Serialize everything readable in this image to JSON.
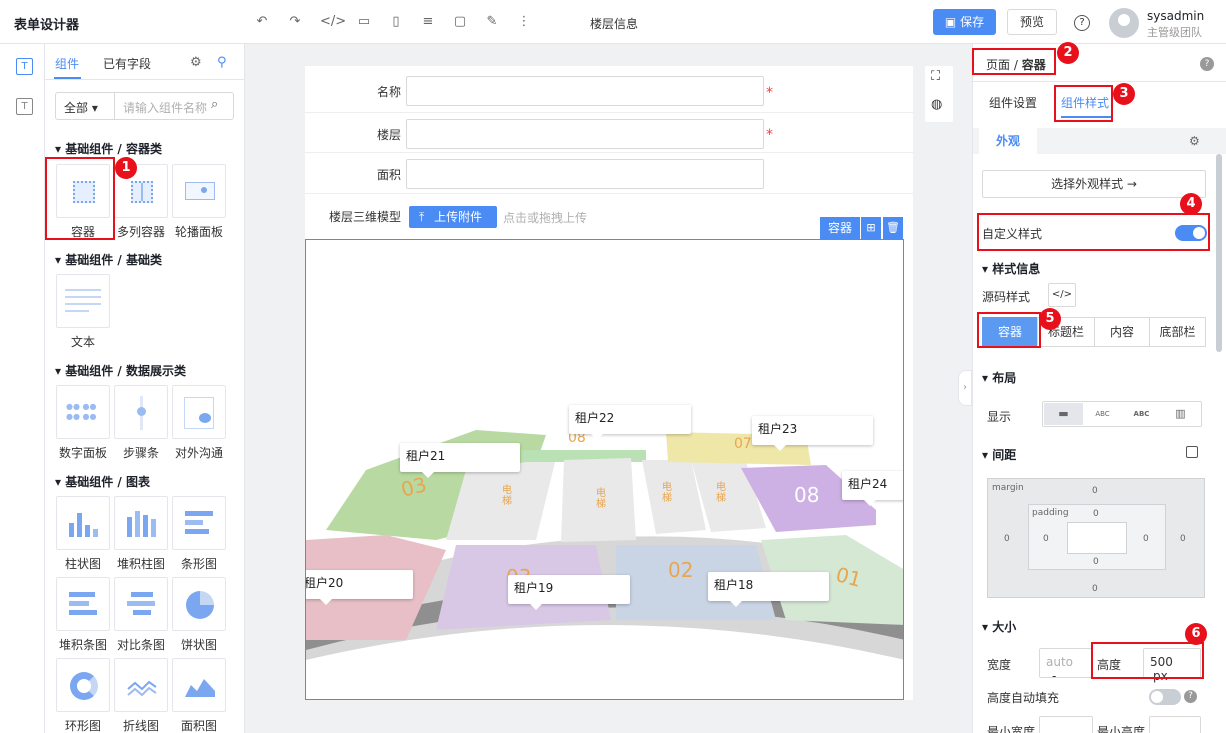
{
  "app": {
    "title": "表单设计器",
    "page_name": "楼层信息"
  },
  "toolbar": {
    "icons": [
      "undo-icon",
      "redo-icon",
      "code-icon",
      "export-icon",
      "layout-icon",
      "database-icon",
      "function-icon",
      "edit-icon",
      "more-icon"
    ]
  },
  "header": {
    "save_label": "保存",
    "preview_label": "预览",
    "help_label": "?",
    "user_name": "sysadmin",
    "user_team": "主管级团队"
  },
  "left_panel": {
    "tabs": [
      "组件",
      "已有字段"
    ],
    "filter_value": "全部",
    "search_placeholder": "请输入组件名称",
    "categories": [
      {
        "title": "基础组件 / 容器类",
        "items": [
          "容器",
          "多列容器",
          "轮播面板"
        ]
      },
      {
        "title": "基础组件 / 基础类",
        "items": [
          "文本"
        ]
      },
      {
        "title": "基础组件 / 数据展示类",
        "items": [
          "数字面板",
          "步骤条",
          "对外沟通"
        ]
      },
      {
        "title": "基础组件 / 图表",
        "items": [
          "柱状图",
          "堆积柱图",
          "条形图",
          "堆积条图",
          "对比条图",
          "饼状图",
          "环形图",
          "折线图",
          "面积图"
        ]
      }
    ]
  },
  "form": {
    "fields": [
      {
        "label": "名称",
        "required": true
      },
      {
        "label": "楼层",
        "required": true
      },
      {
        "label": "面积",
        "required": false
      },
      {
        "label": "楼层三维模型",
        "required": false
      }
    ],
    "upload_label": "上传附件",
    "upload_hint": "点击或拖拽上传",
    "required_mark": "*",
    "container_tag": "容器"
  },
  "floor_map": {
    "tenants": [
      "租户22",
      "租户21",
      "租户23",
      "租户24",
      "租户20",
      "租户19",
      "租户18"
    ],
    "room_numbers": [
      "03",
      "08",
      "07",
      "08",
      "03",
      "02",
      "01"
    ],
    "elevator_label": "电梯"
  },
  "right_panel": {
    "breadcrumb_parent": "页面",
    "breadcrumb_sep": "/",
    "breadcrumb_current": "容器",
    "tabs": [
      "组件设置",
      "组件样式"
    ],
    "sub_tab": "外观",
    "choose_style": "选择外观样式 →",
    "custom_style_label": "自定义样式",
    "custom_style_on": true,
    "style_info_title": "样式信息",
    "source_style_label": "源码样式",
    "segments": [
      "容器",
      "标题栏",
      "内容",
      "底部栏"
    ],
    "layout_title": "布局",
    "display_label": "显示",
    "display_options": [
      "▬",
      "ABC",
      "ABC",
      "▥"
    ],
    "spacing_title": "间距",
    "box_model": {
      "margin_label": "margin",
      "padding_label": "padding",
      "values": [
        "0",
        "0",
        "0",
        "0",
        "0",
        "0",
        "0",
        "0"
      ]
    },
    "size_title": "大小",
    "width_label": "宽度",
    "width_placeholder": "auto",
    "dash": "-",
    "height_label": "高度",
    "height_value": "500",
    "height_unit": "px",
    "auto_fill_label": "高度自动填充",
    "min_width_label": "最小宽度",
    "min_height_label": "最小高度"
  },
  "annotations": [
    "1",
    "2",
    "3",
    "4",
    "5",
    "6"
  ],
  "colors": {
    "accent": "#4b8bf4",
    "highlight": "#e8101b"
  }
}
